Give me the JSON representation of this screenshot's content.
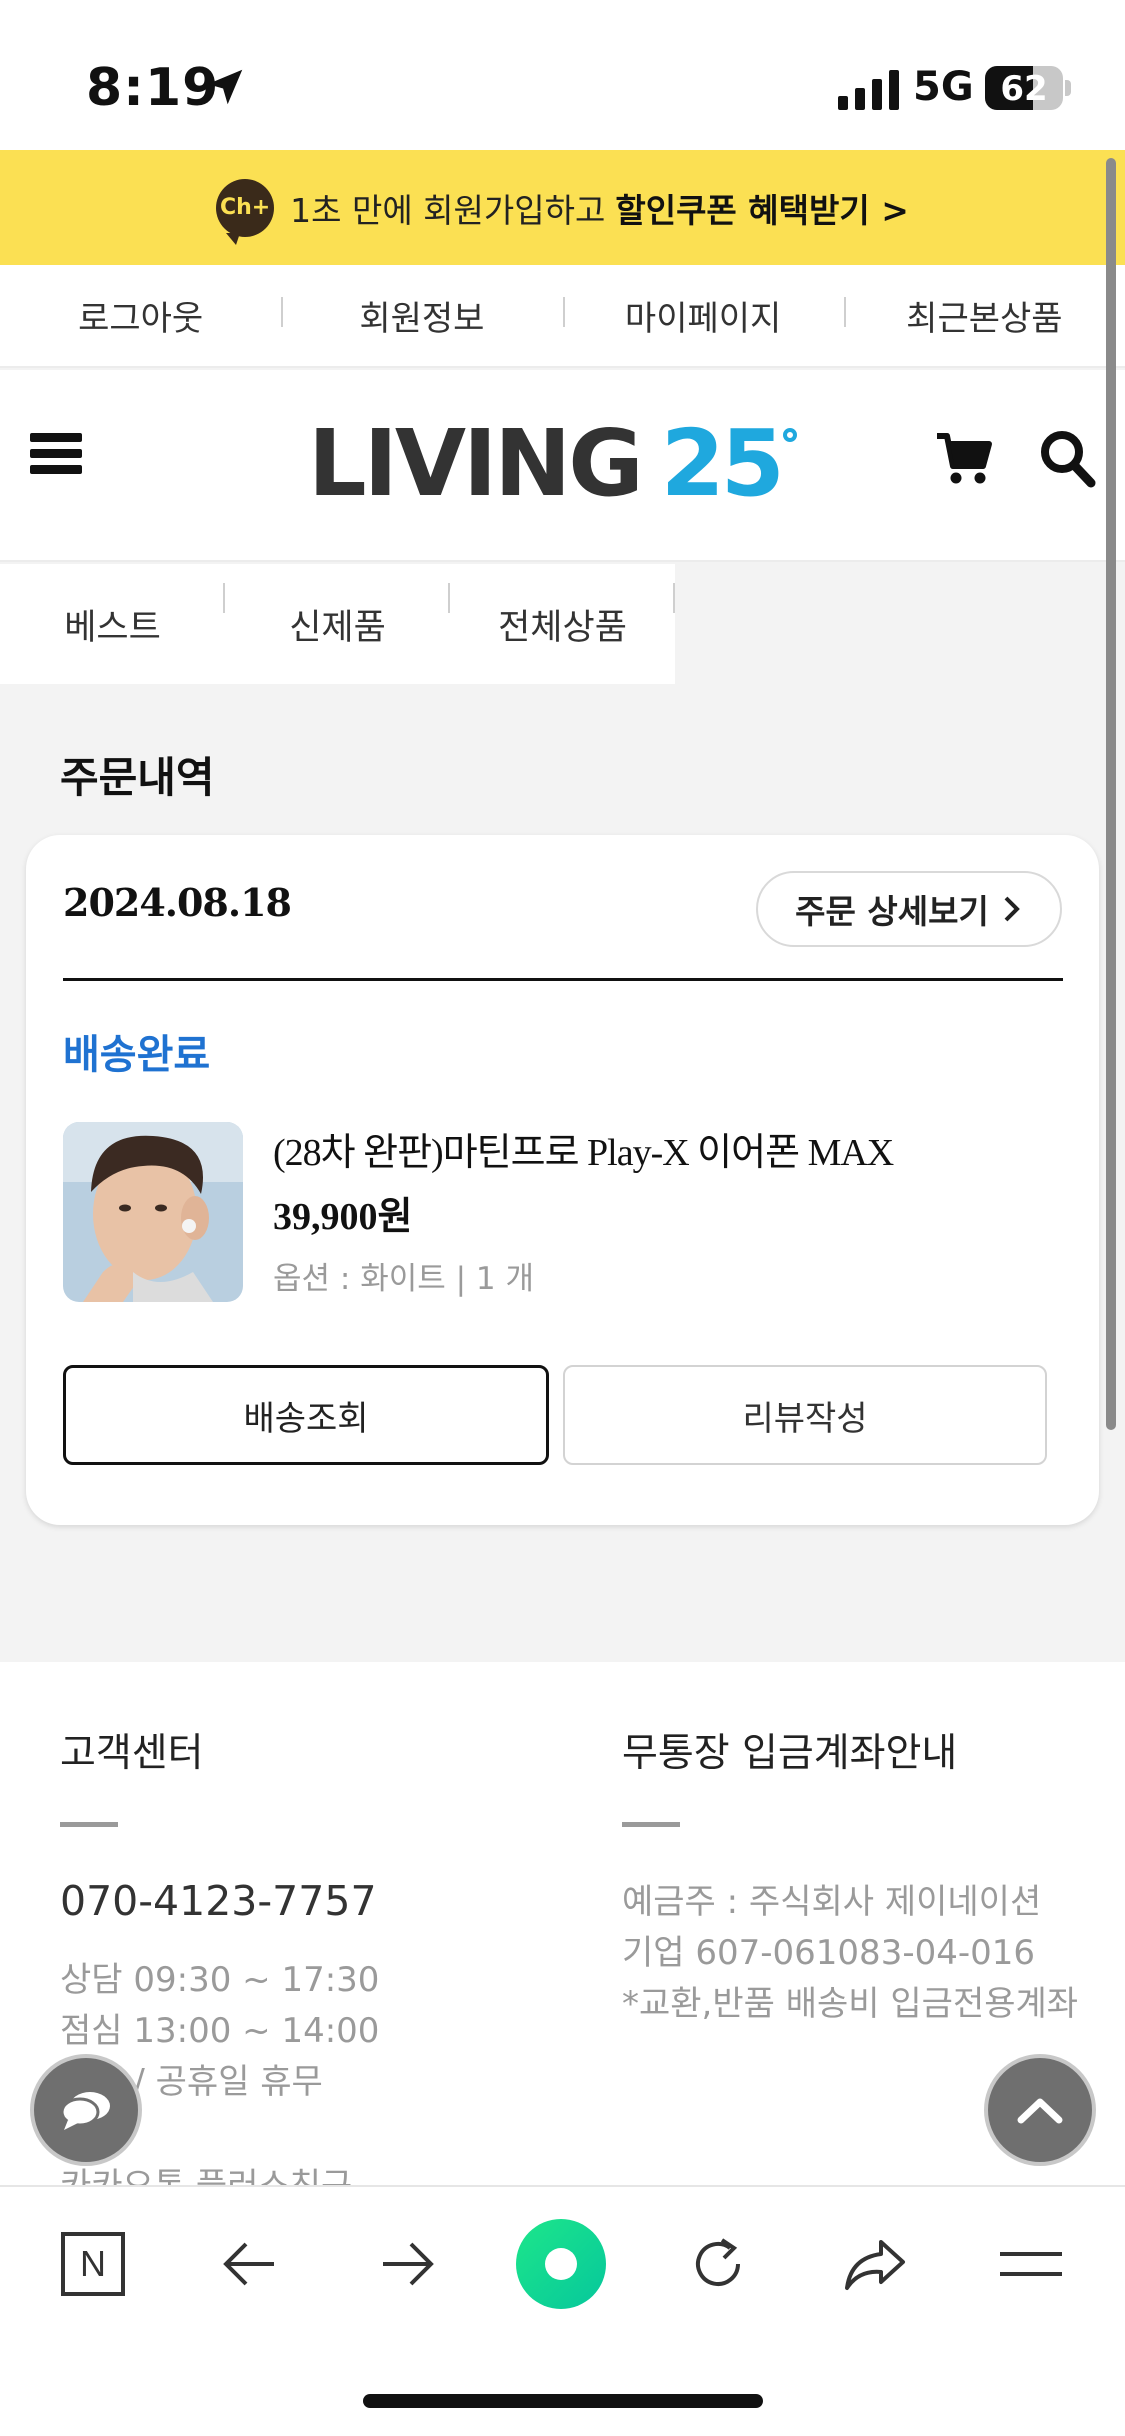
{
  "status_bar": {
    "time": "8:19",
    "network": "5G",
    "battery": "62",
    "battery_level": 0.62
  },
  "promo_banner": {
    "badge": "Ch+",
    "text": "1초 만에 회원가입하고",
    "strong_text": "할인쿠폰 혜택받기 >"
  },
  "util_nav": {
    "items": [
      {
        "label": "로그아웃"
      },
      {
        "label": "회원정보"
      },
      {
        "label": "마이페이지"
      },
      {
        "label": "최근본상품"
      }
    ]
  },
  "header": {
    "logo_word": "LIVING",
    "logo_number": "25"
  },
  "category_nav": {
    "items": [
      {
        "label": "베스트"
      },
      {
        "label": "신제품"
      },
      {
        "label": "전체상품"
      }
    ]
  },
  "page": {
    "title": "주문내역"
  },
  "order": {
    "date": "2024.08.18",
    "detail_button": "주문 상세보기",
    "status": "배송완료",
    "status_color": "#1f72d1",
    "product": {
      "name": "(28차 완판)마틴프로 Play-X 이어폰 MAX",
      "price": "39,900원",
      "option": "옵션 : 화이트 | 1 개"
    },
    "track_button": "배송조회",
    "review_button": "리뷰작성"
  },
  "footer": {
    "customer_center": {
      "heading": "고객센터",
      "phone": "070-4123-7757",
      "hours": "상담 09:30 ~ 17:30",
      "lunch": "점심 13:00 ~ 14:00",
      "closed": "주말 / 공휴일 휴무",
      "kakao": "카카오톡 플러스친구"
    },
    "bank": {
      "heading": "무통장 입금계좌안내",
      "holder": "예금주 : 주식회사 제이네이션",
      "account": "기업 607-061083-04-016",
      "note": "*교환,반품 배송비 입금전용계좌"
    }
  },
  "browser_bar": {
    "naver_letter": "N",
    "icons": [
      "naver-icon",
      "back-arrow-icon",
      "forward-arrow-icon",
      "green-dot-icon",
      "reload-icon",
      "share-icon",
      "tabs-menu-icon"
    ]
  },
  "colors": {
    "banner_bg": "#fbe053",
    "logo_accent": "#1fa8de",
    "status_blue": "#1f72d1"
  }
}
